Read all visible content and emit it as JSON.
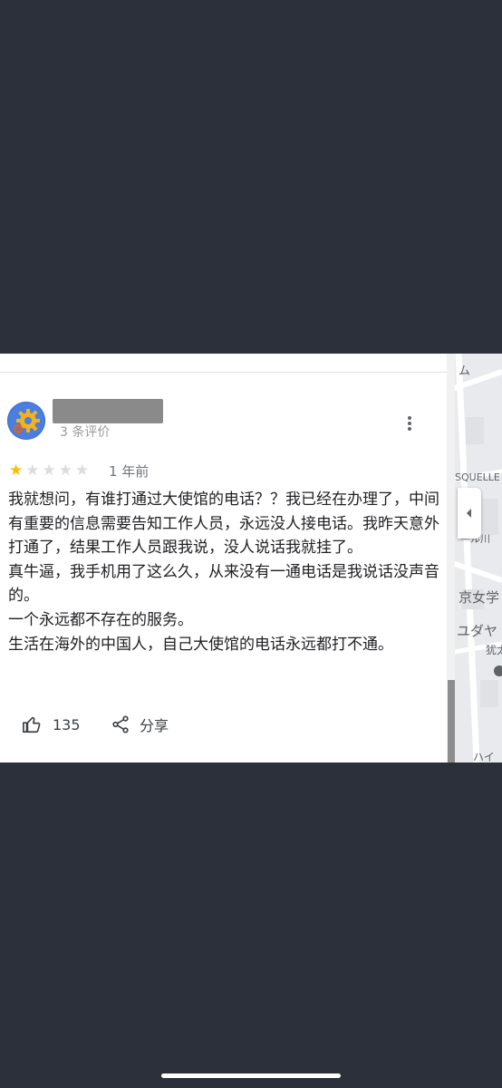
{
  "review": {
    "review_count": "3 条评价",
    "rating": 1,
    "max_rating": 5,
    "time": "1 年前",
    "paragraphs": [
      "我就想问，有谁打通过大使馆的电话？？我已经在办理了，中间有重要的信息需要告知工作人员，永远没人接电话。我昨天意外打通了，结果工作人员跟我说，没人说话我就挂了。",
      "真牛逼，我手机用了这么久，从来没有一通电话是我说话没声音的。",
      "一个永远都不存在的服务。",
      "生活在海外的中国人，自己大使馆的电话永远都打不通。"
    ],
    "likes": "135",
    "share_label": "分享"
  },
  "map": {
    "labels": [
      "ム",
      "SQUELLE",
      "ール川",
      "京女学",
      "ユダヤ",
      "犹太",
      "ハイ"
    ]
  },
  "colors": {
    "background": "#2c303b",
    "star_on": "#fbbc04",
    "star_off": "#dadce0"
  },
  "icons": {
    "like": "thumbs-up-icon",
    "share": "share-icon",
    "more": "more-vert-icon",
    "collapse": "chevron-left-icon"
  }
}
